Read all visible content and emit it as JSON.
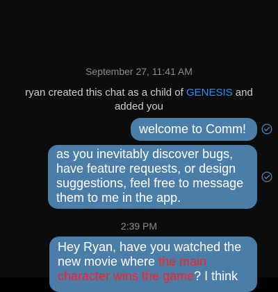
{
  "chat": {
    "timestamps": [
      "September 27, 11:41 AM",
      "2:39 PM"
    ],
    "system": {
      "prefix": "ryan created this chat as a child of ",
      "link": "GENESIS",
      "suffix": " and added you"
    },
    "messages": [
      {
        "text": "welcome to Comm!",
        "status_icon": "check-circle-icon"
      },
      {
        "text": "as you inevitably discover bugs, have feature requests, or design suggestions, feel free to message them to me in the app.",
        "status_icon": "check-circle-icon"
      },
      {
        "text_before": "Hey Ryan, have you watched the new movie where ",
        "text_highlight": "the main character wins the game",
        "text_after": "? I think"
      }
    ]
  },
  "colors": {
    "background": "#0c0c0c",
    "bubble": "#4a7ea8",
    "link": "#2f8fef",
    "highlight": "#ff2020"
  }
}
